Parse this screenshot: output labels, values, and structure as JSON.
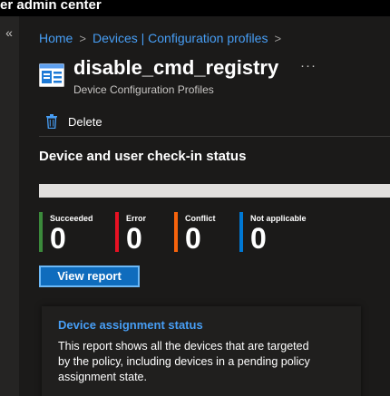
{
  "app": {
    "title": "er admin center"
  },
  "nav": {
    "collapse_glyph": "«"
  },
  "breadcrumb": {
    "items": [
      "Home",
      "Devices | Configuration profiles"
    ],
    "separator": ">"
  },
  "header": {
    "icon": "device-configuration-profile-icon",
    "title": "disable_cmd_registry",
    "subtitle": "Device Configuration Profiles",
    "more_glyph": "···"
  },
  "toolbar": {
    "delete_label": "Delete",
    "delete_icon": "trash-icon"
  },
  "checkin": {
    "title": "Device and user check-in status",
    "progress_succeeded_fraction": 0,
    "stats": [
      {
        "label": "Succeeded",
        "value": "0",
        "color": "#3b8a3b"
      },
      {
        "label": "Error",
        "value": "0",
        "color": "#e81123"
      },
      {
        "label": "Conflict",
        "value": "0",
        "color": "#f7630c"
      },
      {
        "label": "Not applicable",
        "value": "0",
        "color": "#0078d4"
      }
    ],
    "view_report_label": "View report"
  },
  "assignment_card": {
    "title": "Device assignment status",
    "body": "This report shows all the devices that are targeted by the policy, including devices in a pending policy assignment state."
  },
  "colors": {
    "background": "#1b1a19",
    "link": "#479ef5",
    "primary_button": "#0f6cbd",
    "progress_track": "#e1dfdd"
  }
}
